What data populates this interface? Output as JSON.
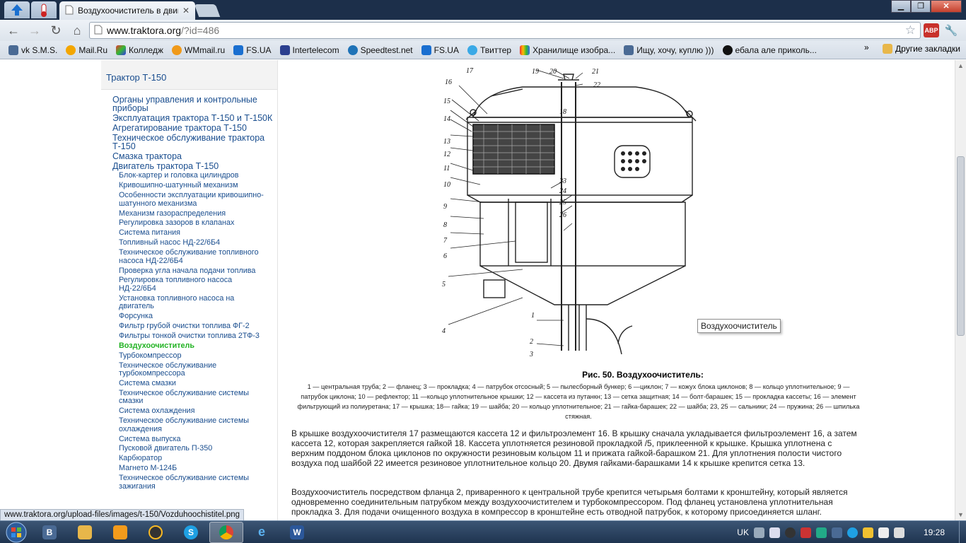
{
  "browser": {
    "tab_title": "Воздухоочиститель в двиг",
    "url_host": "www.traktora.org",
    "url_path": "/?id=486",
    "abp_label": "ABP",
    "bookmarks": [
      "vk S.M.S.",
      "Mail.Ru",
      "Колледж",
      "WMmail.ru",
      "FS.UA",
      "Intertelecom",
      "Speedtest.net",
      "FS.UA",
      "Твиттер",
      "Хранилище изобра...",
      "Ищу, хочу, куплю )))",
      "ебала але приколь..."
    ],
    "bookmarks_more": "»",
    "other_bookmarks": "Другие закладки",
    "status_url": "www.traktora.org/upload-files/images/t-150/Vozduhoochistitel.png"
  },
  "sidebar": {
    "header": "Трактор Т-150",
    "top_items": [
      "Органы управления и контрольные приборы",
      "Эксплуатация трактора Т-150 и Т-150К",
      "Агрегатирование трактора Т-150",
      "Техническое обслуживание трактора Т-150",
      "Смазка трактора",
      "Двигатель трактора Т-150"
    ],
    "sub_items": [
      "Блок-картер и головка цилиндров",
      "Кривошипно-шатунный механизм",
      "Особенности эксплуатации кривошипно-шатунного механизма",
      "Механизм газораспределения",
      "Регулировка зазоров в клапанах",
      "Система питания",
      "Топливный насос НД-22/6Б4",
      "Техническое обслуживание топливного насоса НД-22/6Б4",
      "Проверка угла начала подачи топлива",
      "Регулировка топливного насоса НД-22/6Б4",
      "Установка топливного насоса на двигатель",
      "Форсунка",
      "Фильтр грубой очистки топлива ФГ-2",
      "Фильтры тонкой очистки топлива 2ТФ-3",
      "Воздухоочиститель",
      "Турбокомпрессор",
      "Техническое обслуживание турбокомпрессора",
      "Система смазки",
      "Техническое обслуживание системы смазки",
      "Система охлаждения",
      "Техническое обслуживание системы охлаждения",
      "Система выпуска",
      "Пусковой двигатель П-350",
      "Карбюратор",
      "Магнето М-124Б",
      "Техническое обслуживание системы зажигания"
    ]
  },
  "content": {
    "figure_labels": [
      "17",
      "16",
      "15",
      "14",
      "13",
      "12",
      "11",
      "10",
      "9",
      "8",
      "7",
      "6",
      "5",
      "4",
      "19",
      "20",
      "21",
      "22",
      "18",
      "23",
      "24",
      "25",
      "26",
      "1",
      "2",
      "3"
    ],
    "tooltip": "Воздухоочиститель",
    "caption_title": "Рис. 50. Воздухоочиститель:",
    "caption_text": "1 — центральная труба; 2 — фланец; 3 — прокладка; 4 — патрубок отсосный; 5 — пылесборный бункер; 6 —циклон; 7 — кожух блока циклонов; 8 — кольцо уплотнительное; 9 — патрубок циклона; 10 — рефлектор; 11 —кольцо уплотнительное крышки; 12 — кассета из путанкн; 13 — сетка защитная; 14 — болт-барашек; 15 — прокладка кассеты; 16 — элемент фильтрующий из полиуретана; 17 — крышка; 18— гайка; 19 — шайба; 20 — кольцо уплотнительное; 21 — гайка-барашек; 22 — шайба; 23, 25 — сальники; 24 — пружина; 26 — шпилька стяжная.",
    "para1": "В крышке воздухоочистителя 17 размещаются кассета 12 и фильтроэлемент 16. В крышку сначала укладывается фильтроэлемент 16, а затем кассета 12, которая закрепляется гайкой 18. Кассета уплотняется резиновой прокладкой /5, приклеенной к крышке. Крышка уплотнена с верхним поддоном блока циклонов по окружности резиновым кольцом 11 и прижата гайкой-барашком 21. Для уплотнения полости чистого воздуха под шайбой 22 имеется резиновое уплотнительное кольцо 20. Двумя гайками-барашками 14 к крышке крепится сетка 13.",
    "para2": "Воздухоочиститель посредством фланца 2, приваренного к центральной трубе крепится четырьмя болтами к кронштейну, который является одновременно соединительным патрубком между воздухоочистителем и турбокомпрессором. Под фланец установлена уплотнительная прокладка 3. Для подачи очищенного воздуха в компрессор в кронштейне есть отводной патрубок, к которому присоединяется шланг."
  },
  "taskbar": {
    "lang": "UK",
    "time": "19:28",
    "items": [
      "B",
      "file",
      "media",
      "aimp",
      "skype",
      "chrome",
      "ie",
      "word"
    ]
  }
}
